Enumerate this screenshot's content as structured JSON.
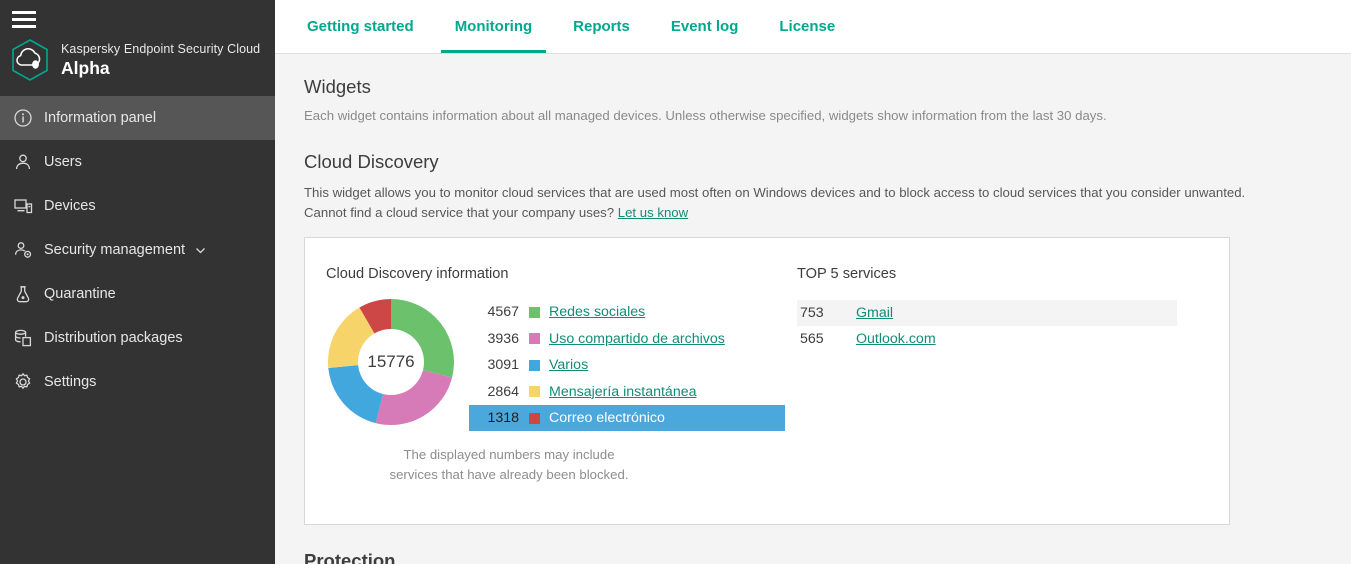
{
  "sidebar": {
    "menu_icon": "hamburger-icon",
    "brand": {
      "logo_icon": "kaspersky-cloud-hexagon-logo",
      "product": "Kaspersky Endpoint Security Cloud",
      "edition": "Alpha"
    },
    "items": [
      {
        "label": "Information panel",
        "icon": "info-circle-icon",
        "active": true,
        "expandable": false
      },
      {
        "label": "Users",
        "icon": "user-icon",
        "active": false,
        "expandable": false
      },
      {
        "label": "Devices",
        "icon": "devices-icon",
        "active": false,
        "expandable": false
      },
      {
        "label": "Security management",
        "icon": "security-gear-icon",
        "active": false,
        "expandable": true
      },
      {
        "label": "Quarantine",
        "icon": "flask-icon",
        "active": false,
        "expandable": false
      },
      {
        "label": "Distribution packages",
        "icon": "packages-icon",
        "active": false,
        "expandable": false
      },
      {
        "label": "Settings",
        "icon": "gear-icon",
        "active": false,
        "expandable": false
      }
    ]
  },
  "tabs": [
    {
      "label": "Getting started",
      "active": false
    },
    {
      "label": "Monitoring",
      "active": true
    },
    {
      "label": "Reports",
      "active": false
    },
    {
      "label": "Event log",
      "active": false
    },
    {
      "label": "License",
      "active": false
    }
  ],
  "page": {
    "widgets_heading": "Widgets",
    "widgets_subtitle": "Each widget contains information about all managed devices. Unless otherwise specified, widgets show information from the last 30 days.",
    "section_heading": "Cloud Discovery",
    "section_desc_line1": "This widget allows you to monitor cloud services that are used most often on Windows devices and to block access to cloud services that you consider unwanted.",
    "section_desc_line2_prefix": "Cannot find a cloud service that your company uses?",
    "section_desc_link": "Let us know",
    "next_section_heading": "Protection"
  },
  "widget": {
    "chart_title": "Cloud Discovery information",
    "top5_title": "TOP 5 services",
    "note": "The displayed numbers may include services that have already been blocked.",
    "top5": [
      {
        "count": "753",
        "name": "Gmail"
      },
      {
        "count": "565",
        "name": "Outlook.com"
      }
    ]
  },
  "chart_data": {
    "type": "pie",
    "title": "Cloud Discovery information",
    "center_label": "15776",
    "total": 15776,
    "donut": true,
    "legend_position": "right",
    "categories": [
      "Redes sociales",
      "Uso compartido de archivos",
      "Varios",
      "Mensajería instantánea",
      "Correo electrónico"
    ],
    "values": [
      4567,
      3936,
      3091,
      2864,
      1318
    ],
    "colors": [
      "#6cc16c",
      "#d77ab8",
      "#42a7dd",
      "#f7d46a",
      "#ce4747"
    ],
    "selected_index": 4,
    "selected_highlight_color": "#4aa8dd"
  },
  "colors": {
    "accent": "#00a88e",
    "link": "#128c77",
    "sidebar_bg": "#333333",
    "sidebar_active": "#565656",
    "page_bg": "#f4f4f4"
  }
}
